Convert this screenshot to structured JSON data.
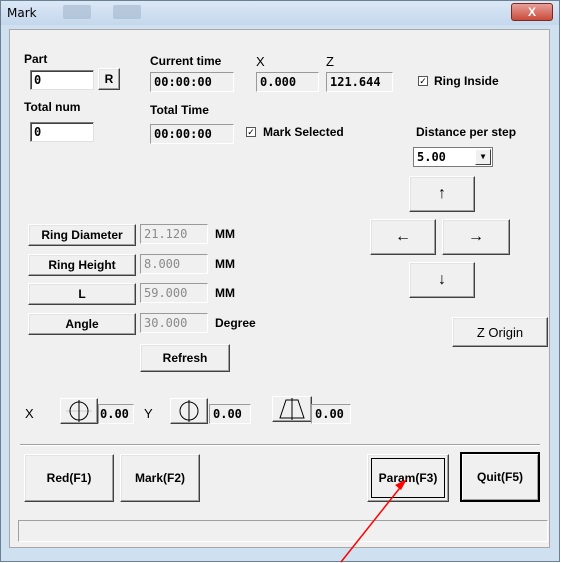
{
  "window": {
    "title": "Mark",
    "close_glyph": "X"
  },
  "position": {
    "part_label": "Part",
    "part_value": "0",
    "reset_label": "R",
    "current_time_label": "Current time",
    "current_time_value": "00:00:00",
    "x_label": "X",
    "x_value": "0.000",
    "z_label": "Z",
    "z_value": "121.644",
    "ring_inside_label": "Ring Inside",
    "ring_inside_checked": true,
    "total_num_label": "Total num",
    "total_num_value": "0",
    "total_time_label": "Total Time",
    "total_time_value": "00:00:00",
    "mark_selected_label": "Mark Selected",
    "mark_selected_checked": true
  },
  "jog": {
    "distance_label": "Distance per step",
    "distance_value": "5.00",
    "up_glyph": "↑",
    "left_glyph": "←",
    "right_glyph": "→",
    "down_glyph": "↓",
    "z_origin_label": "Z Origin"
  },
  "params": {
    "ring_diameter_label": "Ring Diameter",
    "ring_diameter_value": "21.120",
    "ring_diameter_unit": "MM",
    "ring_height_label": "Ring Height",
    "ring_height_value": "8.000",
    "ring_height_unit": "MM",
    "l_label": "L",
    "l_value": "59.000",
    "l_unit": "MM",
    "angle_label": "Angle",
    "angle_value": "30.000",
    "angle_unit": "Degree",
    "refresh_label": "Refresh"
  },
  "gauges": {
    "x_label": "X",
    "x_value": "0.00",
    "y_label": "Y",
    "y_value": "0.00",
    "taper_value": "0.00"
  },
  "actions": {
    "red_label": "Red(F1)",
    "mark_label": "Mark(F2)",
    "param_label": "Param(F3)",
    "quit_label": "Quit(F5)"
  },
  "status_text": ""
}
